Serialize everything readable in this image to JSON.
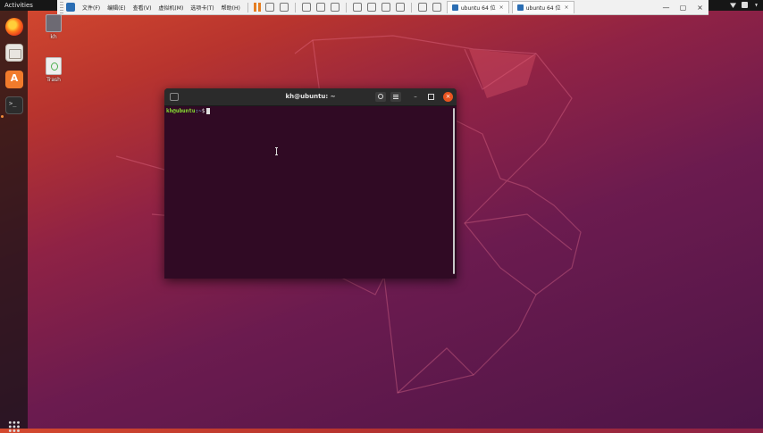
{
  "top_panel": {
    "activities": "Activities"
  },
  "vm_toolbar": {
    "menus": [
      "文件(F)",
      "编辑(E)",
      "查看(V)",
      "虚拟机(M)",
      "选项卡(T)",
      "帮助(H)"
    ],
    "tabs": [
      {
        "label": "ubuntu 64 位",
        "close": "×"
      },
      {
        "label": "ubuntu 64 位",
        "close": "×"
      }
    ],
    "window_controls": {
      "minimize": "—",
      "restore": "▢",
      "close": "×"
    }
  },
  "desktop": {
    "icons": [
      {
        "label": "kh"
      },
      {
        "label": "Trash"
      }
    ]
  },
  "terminal": {
    "title": "kh@ubuntu: ~",
    "prompt_user": "kh@ubuntu",
    "prompt_path": ":~",
    "prompt_symbol": "$",
    "minimize": "–",
    "close": "×"
  },
  "colors": {
    "terminal_bg": "#300a24",
    "prompt_user": "#8ae234",
    "prompt_path": "#729fcf",
    "close_button": "#e9541f",
    "dock_bg": "#141414",
    "accent_orange": "#e67e22"
  }
}
